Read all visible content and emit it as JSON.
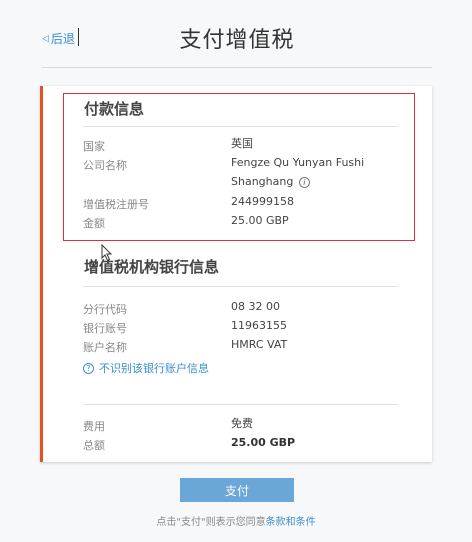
{
  "header": {
    "back_label": "后退",
    "title": "支付增值税"
  },
  "payment_info": {
    "title": "付款信息",
    "rows": [
      {
        "label": "国家",
        "value": "英国"
      },
      {
        "label": "公司名称",
        "value_line1": "Fengze Qu Yunyan Fushi",
        "value_line2": "Shanghang"
      },
      {
        "label": "增值税注册号",
        "value": "244999158"
      },
      {
        "label": "金额",
        "value": "25.00 GBP"
      }
    ]
  },
  "bank_info": {
    "title": "增值税机构银行信息",
    "rows": [
      {
        "label": "分行代码",
        "value": "08 32 00"
      },
      {
        "label": "银行账号",
        "value": "11963155"
      },
      {
        "label": "账户名称",
        "value": "HMRC VAT"
      }
    ],
    "unknown_link": "不识别该银行账户信息"
  },
  "summary": {
    "rows": [
      {
        "label": "费用",
        "value": "免费"
      },
      {
        "label": "总额",
        "value": "25.00 GBP"
      }
    ]
  },
  "pay_button": "支付",
  "terms": {
    "prefix": "点击\"支付\"则表示您同意",
    "link": "条款和条件"
  },
  "colors": {
    "accent_border": "#e2531f",
    "link_blue": "#3a8fd0",
    "button_blue": "#6aa6d8",
    "highlight_red": "#d9343a"
  }
}
